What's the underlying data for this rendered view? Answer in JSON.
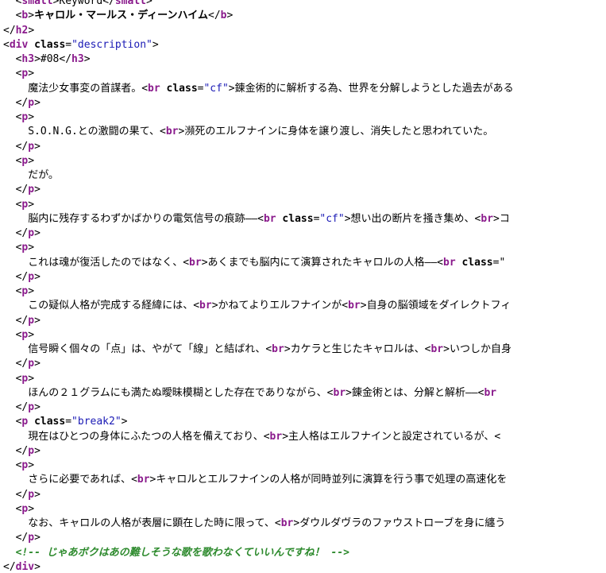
{
  "source": {
    "lines": [
      {
        "indent": 2,
        "parts": [
          [
            "punct",
            "<"
          ],
          [
            "tag",
            "small"
          ],
          [
            "punct",
            ">"
          ],
          [
            "txt",
            "Keyword"
          ],
          [
            "punct",
            "</"
          ],
          [
            "tag",
            "small"
          ],
          [
            "punct",
            ">"
          ]
        ]
      },
      {
        "indent": 2,
        "parts": [
          [
            "punct",
            "<"
          ],
          [
            "tag",
            "b"
          ],
          [
            "punct",
            ">"
          ],
          [
            "bold",
            "キャロル・マールス・ディーンハイム"
          ],
          [
            "punct",
            "</"
          ],
          [
            "tag",
            "b"
          ],
          [
            "punct",
            ">"
          ]
        ]
      },
      {
        "indent": 0,
        "parts": [
          [
            "punct",
            "</"
          ],
          [
            "tag",
            "h2"
          ],
          [
            "punct",
            ">"
          ]
        ]
      },
      {
        "indent": 0,
        "parts": [
          [
            "punct",
            "<"
          ],
          [
            "tag",
            "div"
          ],
          [
            "punct",
            " "
          ],
          [
            "attr",
            "class"
          ],
          [
            "punct",
            "="
          ],
          [
            "str",
            "\"description\""
          ],
          [
            "punct",
            ">"
          ]
        ]
      },
      {
        "indent": 2,
        "parts": [
          [
            "punct",
            "<"
          ],
          [
            "tag",
            "h3"
          ],
          [
            "punct",
            ">"
          ],
          [
            "txt",
            "#08"
          ],
          [
            "punct",
            "</"
          ],
          [
            "tag",
            "h3"
          ],
          [
            "punct",
            ">"
          ]
        ]
      },
      {
        "indent": 2,
        "parts": [
          [
            "punct",
            "<"
          ],
          [
            "tag",
            "p"
          ],
          [
            "punct",
            ">"
          ]
        ]
      },
      {
        "indent": 4,
        "parts": [
          [
            "txt",
            "魔法少女事変の首謀者。"
          ],
          [
            "punct",
            "<"
          ],
          [
            "tag",
            "br"
          ],
          [
            "punct",
            " "
          ],
          [
            "attr",
            "class"
          ],
          [
            "punct",
            "="
          ],
          [
            "str",
            "\"cf\""
          ],
          [
            "punct",
            ">"
          ],
          [
            "txt",
            "錬金術的に解析する為、世界を分解しようとした過去がある"
          ]
        ]
      },
      {
        "indent": 2,
        "parts": [
          [
            "punct",
            "</"
          ],
          [
            "tag",
            "p"
          ],
          [
            "punct",
            ">"
          ]
        ]
      },
      {
        "indent": 2,
        "parts": [
          [
            "punct",
            "<"
          ],
          [
            "tag",
            "p"
          ],
          [
            "punct",
            ">"
          ]
        ]
      },
      {
        "indent": 4,
        "parts": [
          [
            "txt",
            "S.O.N.G.との激闘の果て、"
          ],
          [
            "punct",
            "<"
          ],
          [
            "tag",
            "br"
          ],
          [
            "punct",
            ">"
          ],
          [
            "txt",
            "瀕死のエルフナインに身体を譲り渡し、消失したと思われていた。"
          ]
        ]
      },
      {
        "indent": 2,
        "parts": [
          [
            "punct",
            "</"
          ],
          [
            "tag",
            "p"
          ],
          [
            "punct",
            ">"
          ]
        ]
      },
      {
        "indent": 2,
        "parts": [
          [
            "punct",
            "<"
          ],
          [
            "tag",
            "p"
          ],
          [
            "punct",
            ">"
          ]
        ]
      },
      {
        "indent": 4,
        "parts": [
          [
            "txt",
            "だが。"
          ]
        ]
      },
      {
        "indent": 2,
        "parts": [
          [
            "punct",
            "</"
          ],
          [
            "tag",
            "p"
          ],
          [
            "punct",
            ">"
          ]
        ]
      },
      {
        "indent": 2,
        "parts": [
          [
            "punct",
            "<"
          ],
          [
            "tag",
            "p"
          ],
          [
            "punct",
            ">"
          ]
        ]
      },
      {
        "indent": 4,
        "parts": [
          [
            "txt",
            "脳内に残存するわずかばかりの電気信号の痕跡――"
          ],
          [
            "punct",
            "<"
          ],
          [
            "tag",
            "br"
          ],
          [
            "punct",
            " "
          ],
          [
            "attr",
            "class"
          ],
          [
            "punct",
            "="
          ],
          [
            "str",
            "\"cf\""
          ],
          [
            "punct",
            ">"
          ],
          [
            "txt",
            "想い出の断片を掻き集め、"
          ],
          [
            "punct",
            "<"
          ],
          [
            "tag",
            "br"
          ],
          [
            "punct",
            ">"
          ],
          [
            "txt",
            "コ"
          ]
        ]
      },
      {
        "indent": 2,
        "parts": [
          [
            "punct",
            "</"
          ],
          [
            "tag",
            "p"
          ],
          [
            "punct",
            ">"
          ]
        ]
      },
      {
        "indent": 2,
        "parts": [
          [
            "punct",
            "<"
          ],
          [
            "tag",
            "p"
          ],
          [
            "punct",
            ">"
          ]
        ]
      },
      {
        "indent": 4,
        "parts": [
          [
            "txt",
            "これは魂が復活したのではなく、"
          ],
          [
            "punct",
            "<"
          ],
          [
            "tag",
            "br"
          ],
          [
            "punct",
            ">"
          ],
          [
            "txt",
            "あくまでも脳内にて演算されたキャロルの人格――"
          ],
          [
            "punct",
            "<"
          ],
          [
            "tag",
            "br"
          ],
          [
            "punct",
            " "
          ],
          [
            "attr",
            "class"
          ],
          [
            "punct",
            "=\""
          ]
        ]
      },
      {
        "indent": 2,
        "parts": [
          [
            "punct",
            "</"
          ],
          [
            "tag",
            "p"
          ],
          [
            "punct",
            ">"
          ]
        ]
      },
      {
        "indent": 2,
        "parts": [
          [
            "punct",
            "<"
          ],
          [
            "tag",
            "p"
          ],
          [
            "punct",
            ">"
          ]
        ]
      },
      {
        "indent": 4,
        "parts": [
          [
            "txt",
            "この疑似人格が完成する経緯には、"
          ],
          [
            "punct",
            "<"
          ],
          [
            "tag",
            "br"
          ],
          [
            "punct",
            ">"
          ],
          [
            "txt",
            "かねてよりエルフナインが"
          ],
          [
            "punct",
            "<"
          ],
          [
            "tag",
            "br"
          ],
          [
            "punct",
            ">"
          ],
          [
            "txt",
            "自身の脳領域をダイレクトフィ"
          ]
        ]
      },
      {
        "indent": 2,
        "parts": [
          [
            "punct",
            "</"
          ],
          [
            "tag",
            "p"
          ],
          [
            "punct",
            ">"
          ]
        ]
      },
      {
        "indent": 2,
        "parts": [
          [
            "punct",
            "<"
          ],
          [
            "tag",
            "p"
          ],
          [
            "punct",
            ">"
          ]
        ]
      },
      {
        "indent": 4,
        "parts": [
          [
            "txt",
            "信号瞬く個々の「点」は、やがて「線」と結ばれ、"
          ],
          [
            "punct",
            "<"
          ],
          [
            "tag",
            "br"
          ],
          [
            "punct",
            ">"
          ],
          [
            "txt",
            "カケラと生じたキャロルは、"
          ],
          [
            "punct",
            "<"
          ],
          [
            "tag",
            "br"
          ],
          [
            "punct",
            ">"
          ],
          [
            "txt",
            "いつしか自身"
          ]
        ]
      },
      {
        "indent": 2,
        "parts": [
          [
            "punct",
            "</"
          ],
          [
            "tag",
            "p"
          ],
          [
            "punct",
            ">"
          ]
        ]
      },
      {
        "indent": 2,
        "parts": [
          [
            "punct",
            "<"
          ],
          [
            "tag",
            "p"
          ],
          [
            "punct",
            ">"
          ]
        ]
      },
      {
        "indent": 4,
        "parts": [
          [
            "txt",
            "ほんの２１グラムにも満たぬ曖昧模糊とした存在でありながら、"
          ],
          [
            "punct",
            "<"
          ],
          [
            "tag",
            "br"
          ],
          [
            "punct",
            ">"
          ],
          [
            "txt",
            "錬金術とは、分解と解析――"
          ],
          [
            "punct",
            "<"
          ],
          [
            "tag",
            "br"
          ]
        ]
      },
      {
        "indent": 2,
        "parts": [
          [
            "punct",
            "</"
          ],
          [
            "tag",
            "p"
          ],
          [
            "punct",
            ">"
          ]
        ]
      },
      {
        "indent": 2,
        "parts": [
          [
            "punct",
            "<"
          ],
          [
            "tag",
            "p"
          ],
          [
            "punct",
            " "
          ],
          [
            "attr",
            "class"
          ],
          [
            "punct",
            "="
          ],
          [
            "str",
            "\"break2\""
          ],
          [
            "punct",
            ">"
          ]
        ]
      },
      {
        "indent": 4,
        "parts": [
          [
            "txt",
            "現在はひとつの身体にふたつの人格を備えており、"
          ],
          [
            "punct",
            "<"
          ],
          [
            "tag",
            "br"
          ],
          [
            "punct",
            ">"
          ],
          [
            "txt",
            "主人格はエルフナインと設定されているが、"
          ],
          [
            "punct",
            "<"
          ]
        ]
      },
      {
        "indent": 2,
        "parts": [
          [
            "punct",
            "</"
          ],
          [
            "tag",
            "p"
          ],
          [
            "punct",
            ">"
          ]
        ]
      },
      {
        "indent": 2,
        "parts": [
          [
            "punct",
            "<"
          ],
          [
            "tag",
            "p"
          ],
          [
            "punct",
            ">"
          ]
        ]
      },
      {
        "indent": 4,
        "parts": [
          [
            "txt",
            "さらに必要であれば、"
          ],
          [
            "punct",
            "<"
          ],
          [
            "tag",
            "br"
          ],
          [
            "punct",
            ">"
          ],
          [
            "txt",
            "キャロルとエルフナインの人格が同時並列に演算を行う事で処理の高速化を"
          ]
        ]
      },
      {
        "indent": 2,
        "parts": [
          [
            "punct",
            "</"
          ],
          [
            "tag",
            "p"
          ],
          [
            "punct",
            ">"
          ]
        ]
      },
      {
        "indent": 2,
        "parts": [
          [
            "punct",
            "<"
          ],
          [
            "tag",
            "p"
          ],
          [
            "punct",
            ">"
          ]
        ]
      },
      {
        "indent": 4,
        "parts": [
          [
            "txt",
            "なお、キャロルの人格が表層に顕在した時に限って、"
          ],
          [
            "punct",
            "<"
          ],
          [
            "tag",
            "br"
          ],
          [
            "punct",
            ">"
          ],
          [
            "txt",
            "ダウルダヴラのファウストローブを身に纏う"
          ]
        ]
      },
      {
        "indent": 2,
        "parts": [
          [
            "punct",
            "</"
          ],
          [
            "tag",
            "p"
          ],
          [
            "punct",
            ">"
          ]
        ]
      },
      {
        "indent": 2,
        "parts": [
          [
            "comment",
            "<!-- じゃあボクはあの難しそうな歌を歌わなくていいんですね！ -->"
          ]
        ]
      },
      {
        "indent": 0,
        "parts": [
          [
            "punct",
            "</"
          ],
          [
            "tag",
            "div"
          ],
          [
            "punct",
            ">"
          ]
        ]
      }
    ]
  },
  "colors": {
    "tag": "#8a1a8c",
    "string": "#1a1ab5",
    "comment": "#2d8a2d",
    "text": "#000000",
    "background": "#ffffff"
  }
}
